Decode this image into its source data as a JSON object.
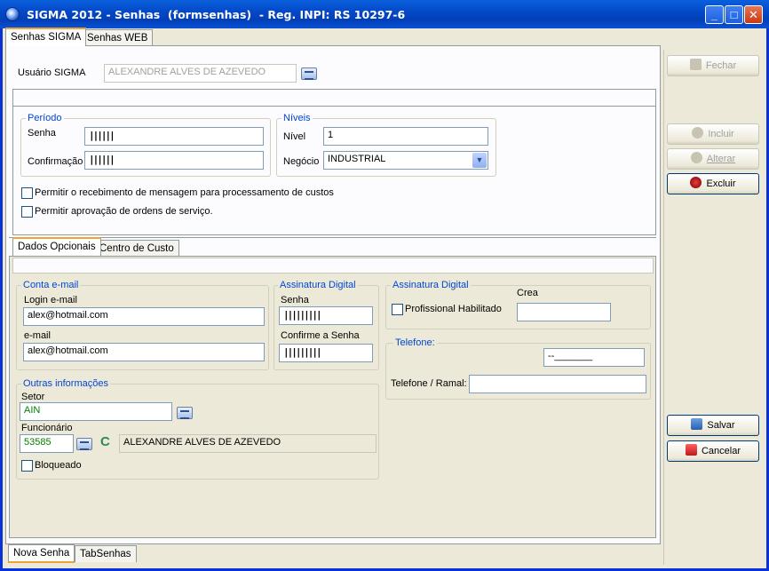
{
  "window": {
    "title": "SIGMA 2012 - Senhas  (formsenhas)  - Reg. INPI: RS 10297-6",
    "minimize": "_",
    "maximize": "□",
    "close": "✕"
  },
  "top_tabs": [
    "Senhas SIGMA",
    "Senhas WEB"
  ],
  "usuario": {
    "label": "Usuário SIGMA",
    "value": "ALEXANDRE ALVES DE AZEVEDO"
  },
  "periodo": {
    "legend": "Período",
    "senha_label": "Senha",
    "senha_value": "||||||",
    "confirmacao_label": "Confirmação",
    "confirmacao_value": "||||||"
  },
  "niveis": {
    "legend": "Níveis",
    "nivel_label": "Nível",
    "nivel_value": "1",
    "negocio_label": "Negócio",
    "negocio_value": "INDUSTRIAL"
  },
  "checks": {
    "msg_custos": "Permitir o recebimento de mensagem para processamento de custos",
    "aprov_os": "Permitir aprovação de ordens de serviço."
  },
  "inner_tabs": [
    "Dados Opcionais",
    "Centro de Custo"
  ],
  "conta_email": {
    "legend": "Conta e-mail",
    "login_label": "Login e-mail",
    "login_value": "alex@hotmail.com",
    "email_label": "e-mail",
    "email_value": "alex@hotmail.com"
  },
  "assinatura": {
    "legend": "Assinatura Digital",
    "senha_label": "Senha",
    "senha_value": "|||||||||",
    "confirme_label": "Confirme a Senha",
    "confirme_value": "|||||||||"
  },
  "assinatura2": {
    "legend": "Assinatura Digital",
    "crea_label": "Crea",
    "prof_label": "Profissional Habilitado"
  },
  "telefone": {
    "legend": "Telefone:",
    "field_value": "--_______",
    "ramal_label": "Telefone / Ramal:"
  },
  "outras": {
    "legend": "Outras informações",
    "setor_label": "Setor",
    "setor_value": "AIN",
    "funcionario_label": "Funcionário",
    "funcionario_code": "53585",
    "funcionario_c": "C",
    "funcionario_name": "ALEXANDRE ALVES DE AZEVEDO",
    "bloqueado_label": "Bloqueado"
  },
  "buttons": {
    "fechar": "Fechar",
    "incluir": "Incluir",
    "alterar": "Alterar",
    "excluir": "Excluir",
    "salvar": "Salvar",
    "cancelar": "Cancelar"
  },
  "bottom_tabs": [
    "Nova Senha",
    "TabSenhas"
  ]
}
